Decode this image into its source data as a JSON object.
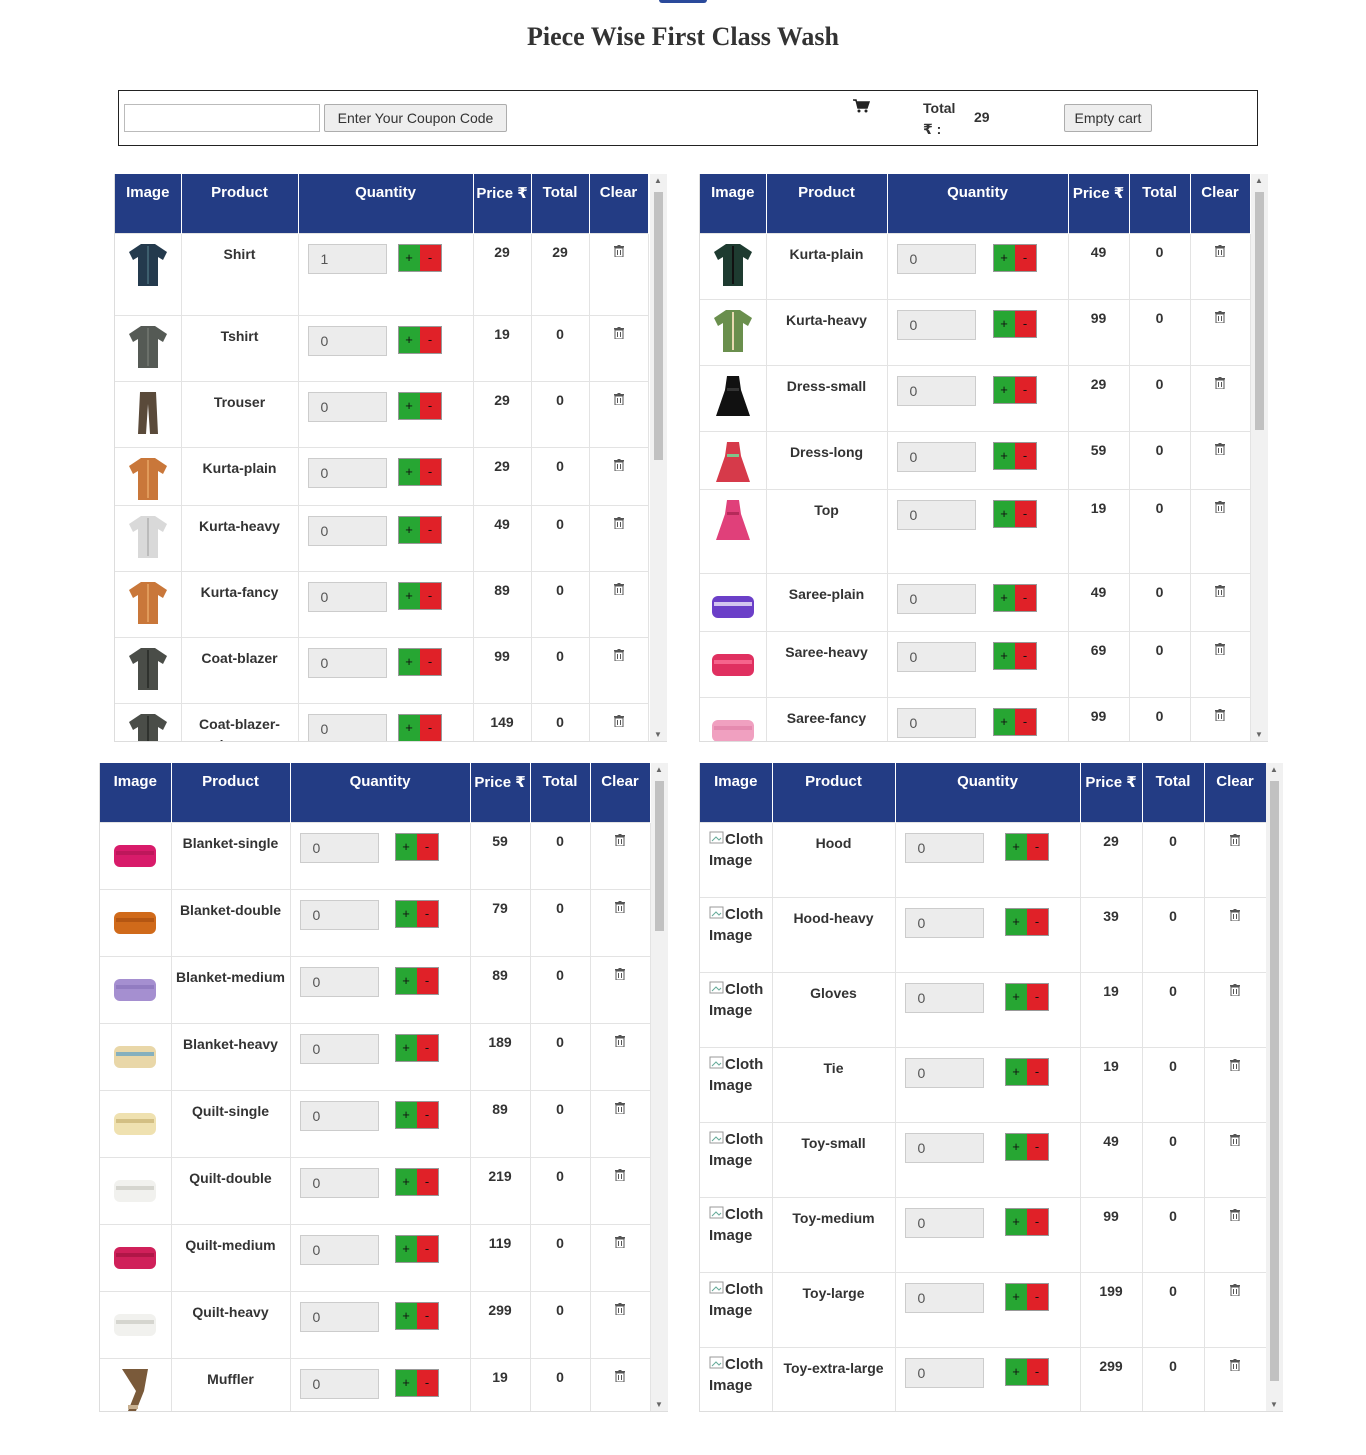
{
  "page": {
    "title": "Piece Wise First Class Wash"
  },
  "coupon": {
    "input_value": "",
    "apply_label": "Enter Your Coupon Code",
    "total_label": "Total ₹ :",
    "total_value": "29",
    "empty_label": "Empty cart"
  },
  "headers": [
    "Image",
    "Product",
    "Quantity",
    "Price ₹",
    "Total",
    "Clear"
  ],
  "panels": [
    {
      "rows": [
        {
          "name": "Shirt",
          "qty": "1",
          "price": "29",
          "total": "29",
          "icon": "shirt"
        },
        {
          "name": "Tshirt",
          "qty": "0",
          "price": "19",
          "total": "0",
          "icon": "tshirt"
        },
        {
          "name": "Trouser",
          "qty": "0",
          "price": "29",
          "total": "0",
          "icon": "trouser"
        },
        {
          "name": "Kurta-plain",
          "qty": "0",
          "price": "29",
          "total": "0",
          "icon": "kurta"
        },
        {
          "name": "Kurta-heavy",
          "qty": "0",
          "price": "49",
          "total": "0",
          "icon": "kurta-white"
        },
        {
          "name": "Kurta-fancy",
          "qty": "0",
          "price": "89",
          "total": "0",
          "icon": "kurta"
        },
        {
          "name": "Coat-blazer",
          "qty": "0",
          "price": "99",
          "total": "0",
          "icon": "coat"
        },
        {
          "name": "Coat-blazer-heavy",
          "qty": "0",
          "price": "149",
          "total": "0",
          "icon": "coat"
        }
      ]
    },
    {
      "rows": [
        {
          "name": "Kurta-plain",
          "qty": "0",
          "price": "49",
          "total": "0",
          "icon": "ladies-kurta"
        },
        {
          "name": "Kurta-heavy",
          "qty": "0",
          "price": "99",
          "total": "0",
          "icon": "ladies-kurta-heavy"
        },
        {
          "name": "Dress-small",
          "qty": "0",
          "price": "29",
          "total": "0",
          "icon": "dress"
        },
        {
          "name": "Dress-long",
          "qty": "0",
          "price": "59",
          "total": "0",
          "icon": "dress-long"
        },
        {
          "name": "Top",
          "qty": "0",
          "price": "19",
          "total": "0",
          "icon": "top"
        },
        {
          "name": "Saree-plain",
          "qty": "0",
          "price": "49",
          "total": "0",
          "icon": "saree"
        },
        {
          "name": "Saree-heavy",
          "qty": "0",
          "price": "69",
          "total": "0",
          "icon": "saree-heavy"
        },
        {
          "name": "Saree-fancy",
          "qty": "0",
          "price": "99",
          "total": "0",
          "icon": "saree-fancy"
        }
      ]
    },
    {
      "rows": [
        {
          "name": "Blanket-single",
          "qty": "0",
          "price": "59",
          "total": "0",
          "icon": "blanket-pink"
        },
        {
          "name": "Blanket-double",
          "qty": "0",
          "price": "79",
          "total": "0",
          "icon": "blanket-orange"
        },
        {
          "name": "Blanket-medium",
          "qty": "0",
          "price": "89",
          "total": "0",
          "icon": "blanket-purple"
        },
        {
          "name": "Blanket-heavy",
          "qty": "0",
          "price": "189",
          "total": "0",
          "icon": "blanket-multi"
        },
        {
          "name": "Quilt-single",
          "qty": "0",
          "price": "89",
          "total": "0",
          "icon": "quilt-cream"
        },
        {
          "name": "Quilt-double",
          "qty": "0",
          "price": "219",
          "total": "0",
          "icon": "quilt-white"
        },
        {
          "name": "Quilt-medium",
          "qty": "0",
          "price": "119",
          "total": "0",
          "icon": "quilt-pink"
        },
        {
          "name": "Quilt-heavy",
          "qty": "0",
          "price": "299",
          "total": "0",
          "icon": "quilt-white"
        },
        {
          "name": "Muffler",
          "qty": "0",
          "price": "19",
          "total": "0",
          "icon": "muffler"
        }
      ]
    },
    {
      "broken_img_alt": "Cloth Image",
      "rows": [
        {
          "name": "Hood",
          "qty": "0",
          "price": "29",
          "total": "0"
        },
        {
          "name": "Hood-heavy",
          "qty": "0",
          "price": "39",
          "total": "0"
        },
        {
          "name": "Gloves",
          "qty": "0",
          "price": "19",
          "total": "0"
        },
        {
          "name": "Tie",
          "qty": "0",
          "price": "19",
          "total": "0"
        },
        {
          "name": "Toy-small",
          "qty": "0",
          "price": "49",
          "total": "0"
        },
        {
          "name": "Toy-medium",
          "qty": "0",
          "price": "99",
          "total": "0"
        },
        {
          "name": "Toy-large",
          "qty": "0",
          "price": "199",
          "total": "0"
        },
        {
          "name": "Toy-extra-large",
          "qty": "0",
          "price": "299",
          "total": "0"
        }
      ]
    }
  ]
}
